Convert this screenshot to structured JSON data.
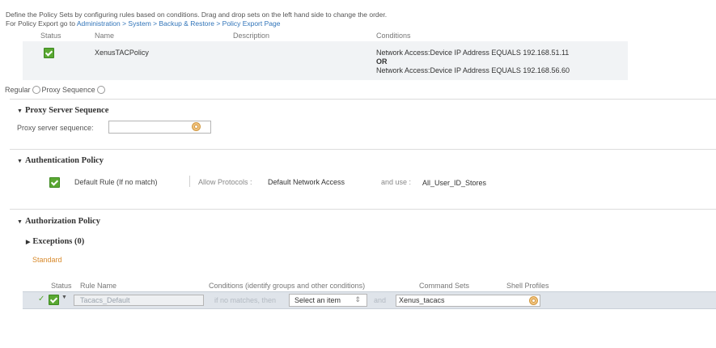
{
  "intro": {
    "line1": "Define the Policy Sets by configuring rules based on conditions. Drag and drop sets on the left hand side to change the order.",
    "line2_prefix": "For Policy Export go to",
    "line2_link": "Administration > System > Backup & Restore > Policy Export Page"
  },
  "policy_sets": {
    "headers": {
      "status": "Status",
      "name": "Name",
      "description": "Description",
      "conditions": "Conditions"
    },
    "row": {
      "name": "XenusTACPolicy",
      "description": "",
      "condition1": "Network Access:Device IP Address EQUALS 192.168.51.11",
      "or": "OR",
      "condition2": "Network Access:Device IP Address EQUALS 192.168.56.60"
    }
  },
  "mode": {
    "regular": "Regular",
    "proxy": "Proxy Sequence"
  },
  "proxy_section": {
    "title": "Proxy Server Sequence",
    "field_label": "Proxy server sequence:",
    "field_value": ""
  },
  "authentication": {
    "title": "Authentication Policy",
    "rule": "Default Rule (If no match)",
    "allow_label": "Allow Protocols :",
    "allow_value": "Default Network Access",
    "and_use": "and use :",
    "identity_store": "All_User_ID_Stores"
  },
  "authorization": {
    "title": "Authorization Policy",
    "exceptions": "Exceptions (0)",
    "standard": "Standard",
    "headers": {
      "status": "Status",
      "rule_name": "Rule Name",
      "conditions": "Conditions (identify groups and other conditions)",
      "command_sets": "Command Sets",
      "shell_profiles": "Shell Profiles"
    },
    "row": {
      "rule_name": "Tacacs_Default",
      "if_no_matches": "if no matches, then",
      "select_placeholder": "Select an item",
      "and": "and",
      "shell_profile": "Xenus_tacacs"
    }
  }
}
